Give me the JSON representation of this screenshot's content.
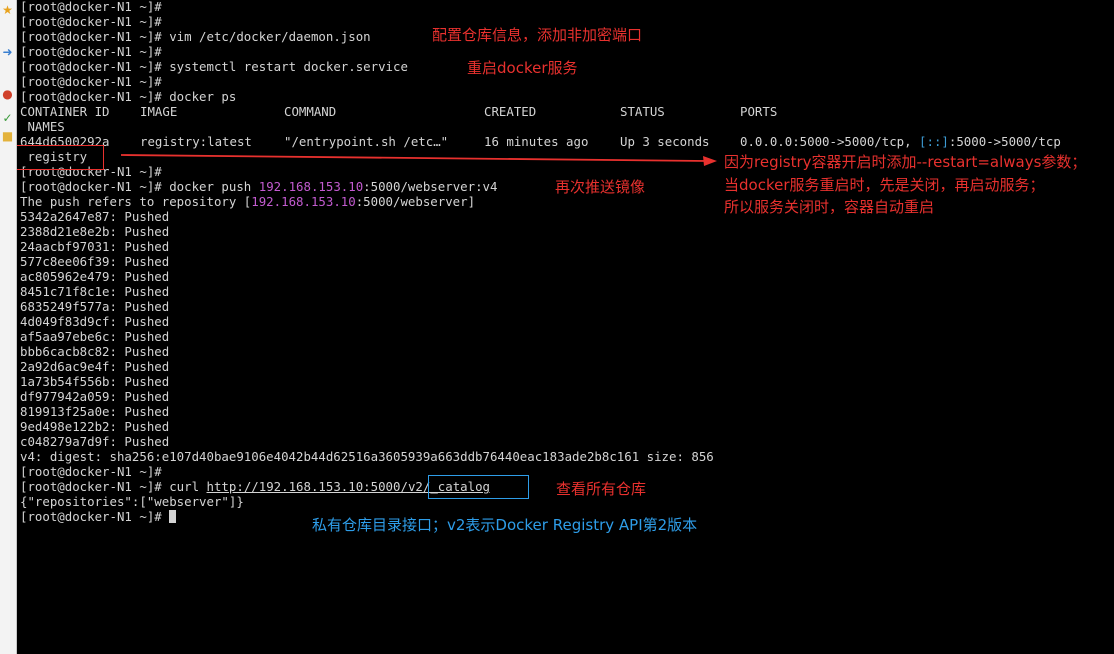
{
  "sidebar": {
    "icons": [
      {
        "name": "star-icon",
        "glyph": "★",
        "color": "#e8a21c"
      },
      {
        "name": "arrow-icon",
        "glyph": "➜",
        "color": "#3a7fd0"
      },
      {
        "name": "circle-icon",
        "glyph": "●",
        "color": "#d0402a"
      },
      {
        "name": "check-icon",
        "glyph": "✓",
        "color": "#3a9a3a"
      },
      {
        "name": "folder-icon",
        "glyph": "■",
        "color": "#e3b23c"
      }
    ]
  },
  "terminal": {
    "prompt": "[root@docker-N1 ~]#",
    "cmd_vim": " vim /etc/docker/daemon.json",
    "cmd_restart": " systemctl restart docker.service",
    "cmd_ps": " docker ps",
    "table": {
      "headers": [
        "CONTAINER ID",
        "IMAGE",
        "COMMAND",
        "CREATED",
        "STATUS",
        "PORTS"
      ],
      "names_header": " NAMES",
      "row": {
        "id": "644d6500292a",
        "image": "registry:latest",
        "command": "\"/entrypoint.sh /etc…\"",
        "created": "16 minutes ago",
        "status": "Up 3 seconds",
        "ports_a": "0.0.0.0:5000->5000/tcp, ",
        "ports_b": "[::]",
        "ports_c": ":5000->5000/tcp",
        "name": " registry"
      }
    },
    "cmd_push_a": " docker push ",
    "ip": "192.168.153.10",
    "cmd_push_b": ":5000/webserver:v4",
    "refers_a": "The push refers to repository [",
    "refers_b": ":5000/webserver]",
    "layers": [
      "5342a2647e87: Pushed",
      "2388d21e8e2b: Pushed",
      "24aacbf97031: Pushed",
      "577c8ee06f39: Pushed",
      "ac805962e479: Pushed",
      "8451c71f8c1e: Pushed",
      "6835249f577a: Pushed",
      "4d049f83d9cf: Pushed",
      "af5aa97ebe6c: Pushed",
      "bbb6cacb8c82: Pushed",
      "2a92d6ac9e4f: Pushed",
      "1a73b54f556b: Pushed",
      "df977942a059: Pushed",
      "819913f25a0e: Pushed",
      "9ed498e122b2: Pushed",
      "c048279a7d9f: Pushed"
    ],
    "digest": "v4: digest: sha256:e107d40bae9106e4042b44d62516a3605939a663ddb76440eac183ade2b8c161 size: 856",
    "curl_cmd": " curl ",
    "curl_url_a": "http://192.168.153.10:5000",
    "curl_url_b": "/v2/_catalog",
    "curl_result": "{\"repositories\":[\"webserver\"]}"
  },
  "annotations": {
    "config": "配置仓库信息，添加非加密端口",
    "restart": "重启docker服务",
    "push_again": "再次推送镜像",
    "reason_1": "因为registry容器开启时添加--restart=always参数；",
    "reason_2": "当docker服务重启时，先是关闭，再启动服务；",
    "reason_3": "所以服务关闭时，容器自动重启",
    "catalog": "查看所有仓库",
    "catalog_api": "私有仓库目录接口；v2表示Docker Registry API第2版本"
  },
  "colors": {
    "annotation_red": "#e8312e",
    "annotation_blue": "#2e9de8",
    "ip_magenta": "#c35bd0",
    "terminal_bg": "#000000",
    "terminal_fg": "#d4d4d4"
  }
}
